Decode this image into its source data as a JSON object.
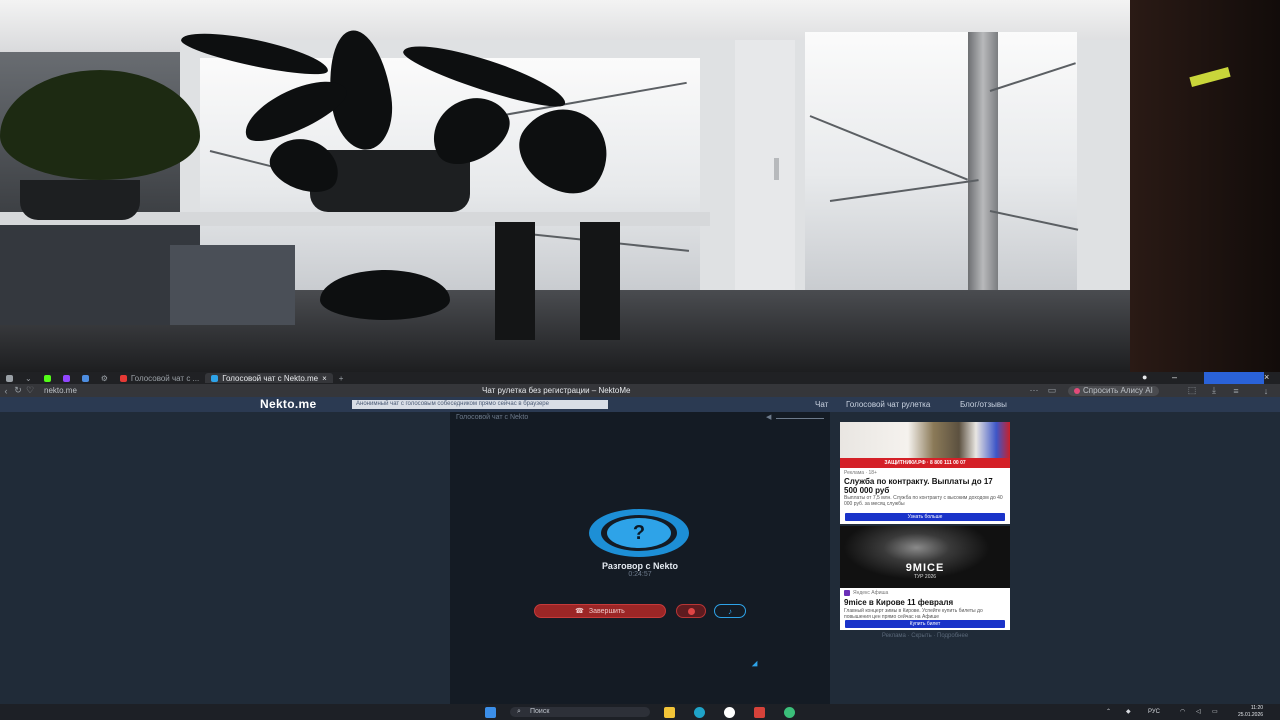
{
  "browser": {
    "tabs": [
      {
        "label": "",
        "icon": "browser-menu-icon"
      },
      {
        "label": "",
        "icon": "dropdown-icon"
      },
      {
        "label": "",
        "icon": "kick-icon"
      },
      {
        "label": "",
        "icon": "twitch-icon"
      },
      {
        "label": "",
        "icon": "screen-icon"
      },
      {
        "label": "",
        "icon": "settings-icon"
      },
      {
        "label": "Голосовой чат с ...",
        "icon": "youtube-icon"
      },
      {
        "label": "Голосовой чат с Nekto.me",
        "icon": "nekto-icon",
        "active": true
      }
    ],
    "new_tab": "+",
    "url": "nekto.me",
    "page_title": "Чат рулетка без регистрации – NektoMe",
    "ai_button": "Спросить Алису AI",
    "colors": {
      "tab_bar": "#202124",
      "address_bar": "#35363a"
    }
  },
  "site": {
    "logo": "Nekto.me",
    "banner": "Анонимный чат с голосовым собеседником прямо сейчас в браузере",
    "menu": [
      "Чат",
      "Голосовой чат рулетка",
      "Блог/отзывы"
    ],
    "header_color": "#2b3a52"
  },
  "voice_panel": {
    "title": "Голосовой чат с Nekto",
    "conversation_label": "Разговор с Nekto",
    "timer": "0:24:57",
    "end_button": "Завершить",
    "logo_symbol": "?",
    "accent": "#2ea3e8"
  },
  "ads": [
    {
      "image_stripe": "ЗАЩИТНИКИ.РФ · 8 800 111 00 07",
      "source": "Реклама · 18+",
      "headline": "Служба по контракту. Выплаты до 17 500 000 руб",
      "text": "Выплаты от 7,5 млн. Служба по контракту с высоким доходом до 40 000 руб. за месяц службы",
      "cta": "Узнать больше"
    },
    {
      "image_brand": "9MICE",
      "image_sub": "ТУР 2026",
      "source": "Яндекс Афиша",
      "headline": "9mice в Кирове 11 февраля",
      "text": "Главный концерт зимы в Кирове. Успейте купить билеты до повышения цен прямо сейчас на Афише",
      "cta": "Купить билет"
    }
  ],
  "ads_caption": "Реклама · Скрыть · Подробнее",
  "taskbar": {
    "search_placeholder": "Поиск",
    "language": "РУС",
    "time": "11:20",
    "date": "25.01.2026"
  }
}
